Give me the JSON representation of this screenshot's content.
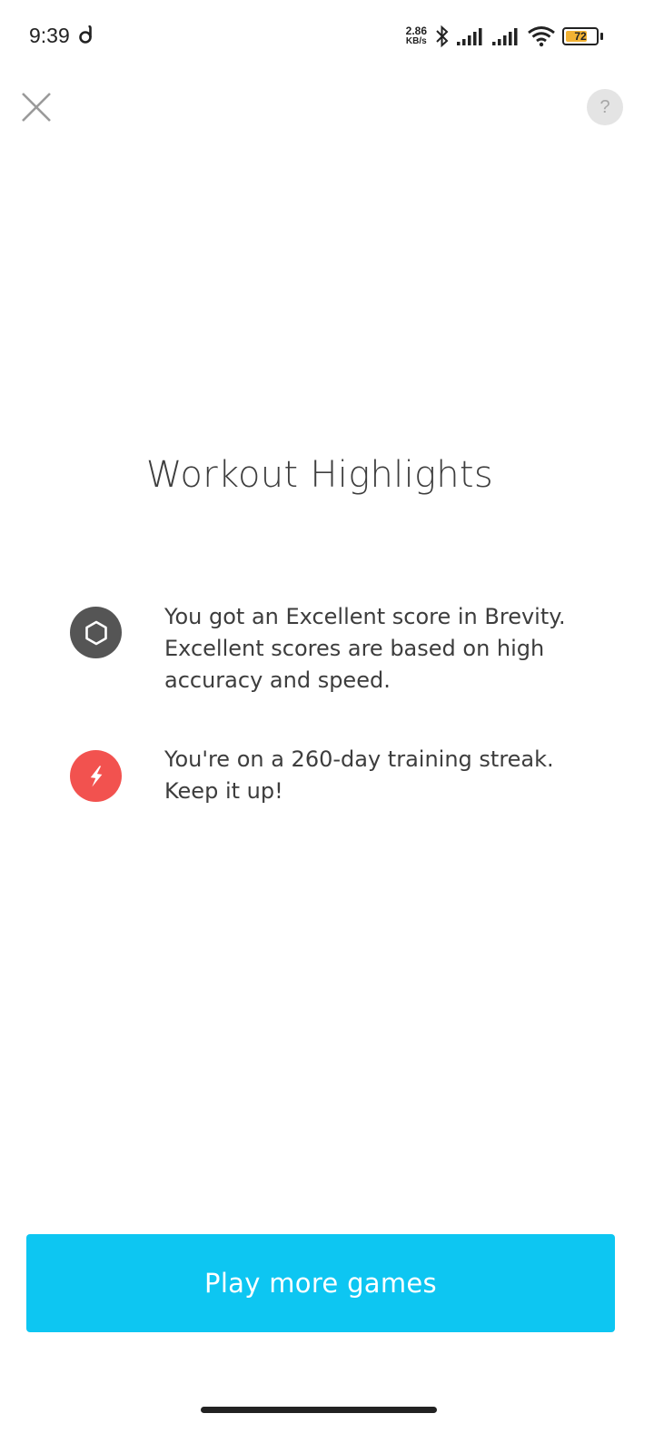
{
  "status_bar": {
    "time": "9:39",
    "net_speed_value": "2.86",
    "net_speed_unit": "KB/s",
    "battery_level": "72",
    "battery_fraction": 0.72,
    "icons": [
      "app-d-icon",
      "bluetooth-icon",
      "signal-icon",
      "signal-icon",
      "wifi-icon",
      "battery-icon"
    ]
  },
  "header": {
    "close_icon": "close-icon",
    "help_label": "?"
  },
  "main": {
    "title": "Workout Highlights",
    "highlights": [
      {
        "icon": "hexagon-badge-icon",
        "color": "#555555",
        "lines": [
          "You got an Excellent score in Brevity.",
          "Excellent scores are based on high",
          "accuracy and speed."
        ]
      },
      {
        "icon": "lightning-bolt-icon",
        "color": "#f2524f",
        "lines": [
          "You're on a 260-day training streak.",
          "Keep it up!"
        ]
      }
    ]
  },
  "footer": {
    "play_button_label": "Play more games",
    "accent_color": "#0dc6f2"
  }
}
